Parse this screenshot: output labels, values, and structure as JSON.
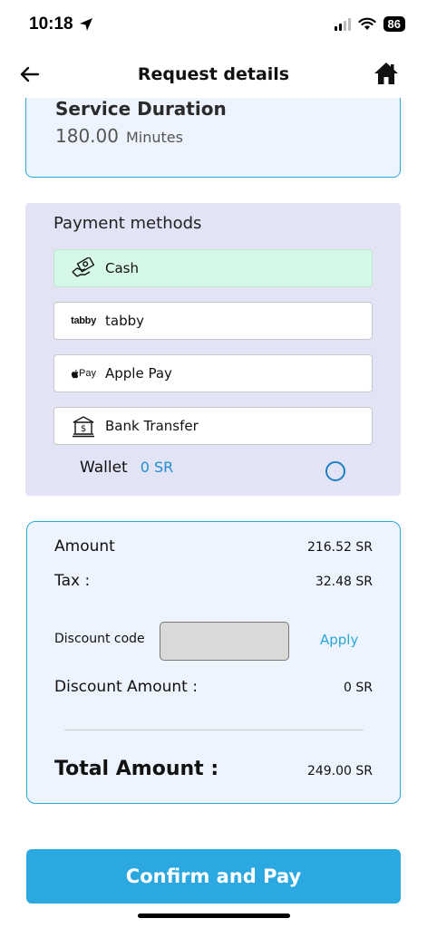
{
  "status_bar": {
    "time": "10:18",
    "battery": "86"
  },
  "header": {
    "title": "Request details"
  },
  "service_duration": {
    "title": "Service Duration",
    "value": "180.00",
    "unit": "Minutes"
  },
  "payment": {
    "title": "Payment methods",
    "options": [
      {
        "label": "Cash",
        "icon": "cash-icon",
        "selected": true
      },
      {
        "label": "tabby",
        "icon": "tabby-logo",
        "logo_text": "tabby",
        "selected": false
      },
      {
        "label": "Apple Pay",
        "icon": "apple-pay-logo",
        "logo_text": "Pay",
        "selected": false
      },
      {
        "label": "Bank Transfer",
        "icon": "bank-icon",
        "selected": false
      }
    ],
    "wallet": {
      "label": "Wallet",
      "amount": "0 SR",
      "selected": false
    }
  },
  "summary": {
    "amount_label": "Amount",
    "amount_value": "216.52 SR",
    "tax_label": "Tax :",
    "tax_value": "32.48 SR",
    "discount_code_label": "Discount code",
    "discount_code_value": "",
    "apply_label": "Apply",
    "discount_amount_label": "Discount Amount :",
    "discount_amount_value": "0 SR",
    "total_label": "Total Amount :",
    "total_value": "249.00 SR"
  },
  "confirm_button": {
    "label": "Confirm and Pay"
  },
  "colors": {
    "accent": "#2aa8df",
    "selected_option": "#d6f8e6",
    "payment_bg": "#e3e3f6",
    "card_bg": "#eef4fd"
  }
}
